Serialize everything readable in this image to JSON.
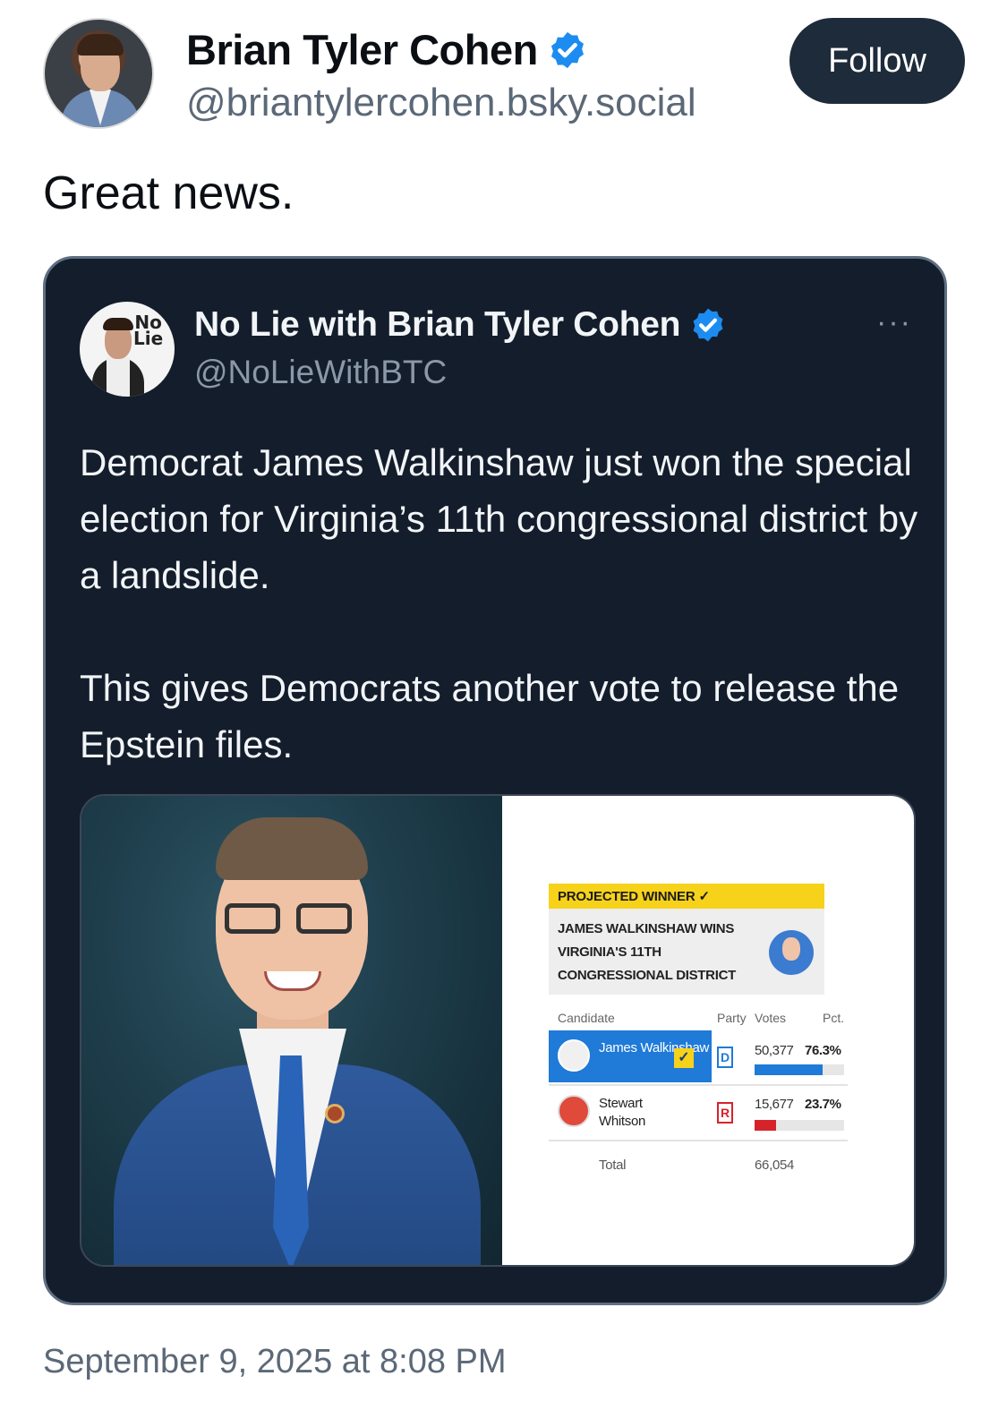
{
  "post": {
    "author_name": "Brian Tyler Cohen",
    "author_handle": "@briantylercohen.bsky.social",
    "follow_label": "Follow",
    "text": "Great news.",
    "timestamp": "September 9, 2025 at 8:08 PM"
  },
  "quoted": {
    "author_name": "No Lie with Brian Tyler Cohen",
    "author_handle": "@NoLieWithBTC",
    "avatar_logo": "No Lie",
    "more_icon": "···",
    "paragraphs": [
      "Democrat James Walkinshaw just won the special election for Virginia’s 11th congressional district by a landslide.",
      "This gives Democrats another vote to release the Epstein files."
    ]
  },
  "results_graphic": {
    "banner": "PROJECTED WINNER ✓",
    "headline": "JAMES WALKINSHAW WINS VIRGINIA'S 11TH CONGRESSIONAL DISTRICT",
    "headers": {
      "candidate": "Candidate",
      "party": "Party",
      "votes": "Votes",
      "pct": "Pct."
    },
    "candidates": [
      {
        "name": "James Walkinshaw",
        "party": "D",
        "votes": "50,377",
        "pct": "76.3%",
        "share": 0.763,
        "winner": true
      },
      {
        "name": "Stewart Whitson",
        "party": "R",
        "votes": "15,677",
        "pct": "23.7%",
        "share": 0.237,
        "winner": false
      }
    ],
    "total_label": "Total",
    "total_votes": "66,054"
  },
  "colors": {
    "verified": "#1d8cf0",
    "card_bg": "#141d2b",
    "democrat": "#1f7ad8",
    "republican": "#d6232a",
    "banner": "#f7d21a"
  },
  "icons": {
    "verified": "verified-badge-icon",
    "more": "more-options-icon"
  }
}
